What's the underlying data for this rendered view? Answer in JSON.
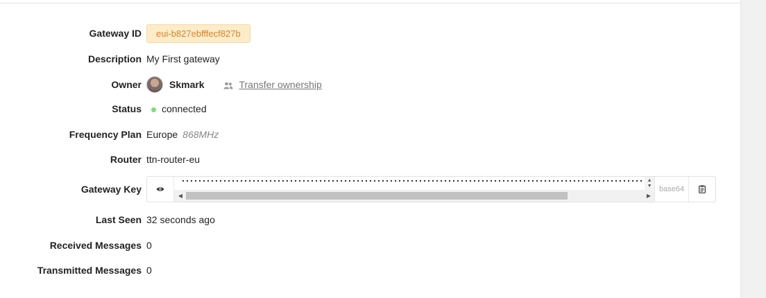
{
  "fields": {
    "gateway_id": {
      "label": "Gateway ID",
      "value": "eui-b827ebfffecf827b"
    },
    "description": {
      "label": "Description",
      "value": "My First gateway"
    },
    "owner": {
      "label": "Owner",
      "name": "Skmark",
      "transfer_label": "Transfer ownership",
      "icon": "users-icon"
    },
    "status": {
      "label": "Status",
      "value": "connected",
      "color": "#7cdb7a"
    },
    "frequency_plan": {
      "label": "Frequency Plan",
      "value": "Europe",
      "detail": "868MHz"
    },
    "router": {
      "label": "Router",
      "value": "ttn-router-eu"
    },
    "gateway_key": {
      "label": "Gateway Key",
      "format": "base64",
      "show_icon": "eye-icon",
      "copy_icon": "clipboard-icon"
    },
    "last_seen": {
      "label": "Last Seen",
      "value": "32 seconds ago"
    },
    "received": {
      "label": "Received Messages",
      "value": "0"
    },
    "transmitted": {
      "label": "Transmitted Messages",
      "value": "0"
    }
  },
  "colors": {
    "badge_bg": "#fdecc8",
    "badge_text": "#d9822b"
  }
}
